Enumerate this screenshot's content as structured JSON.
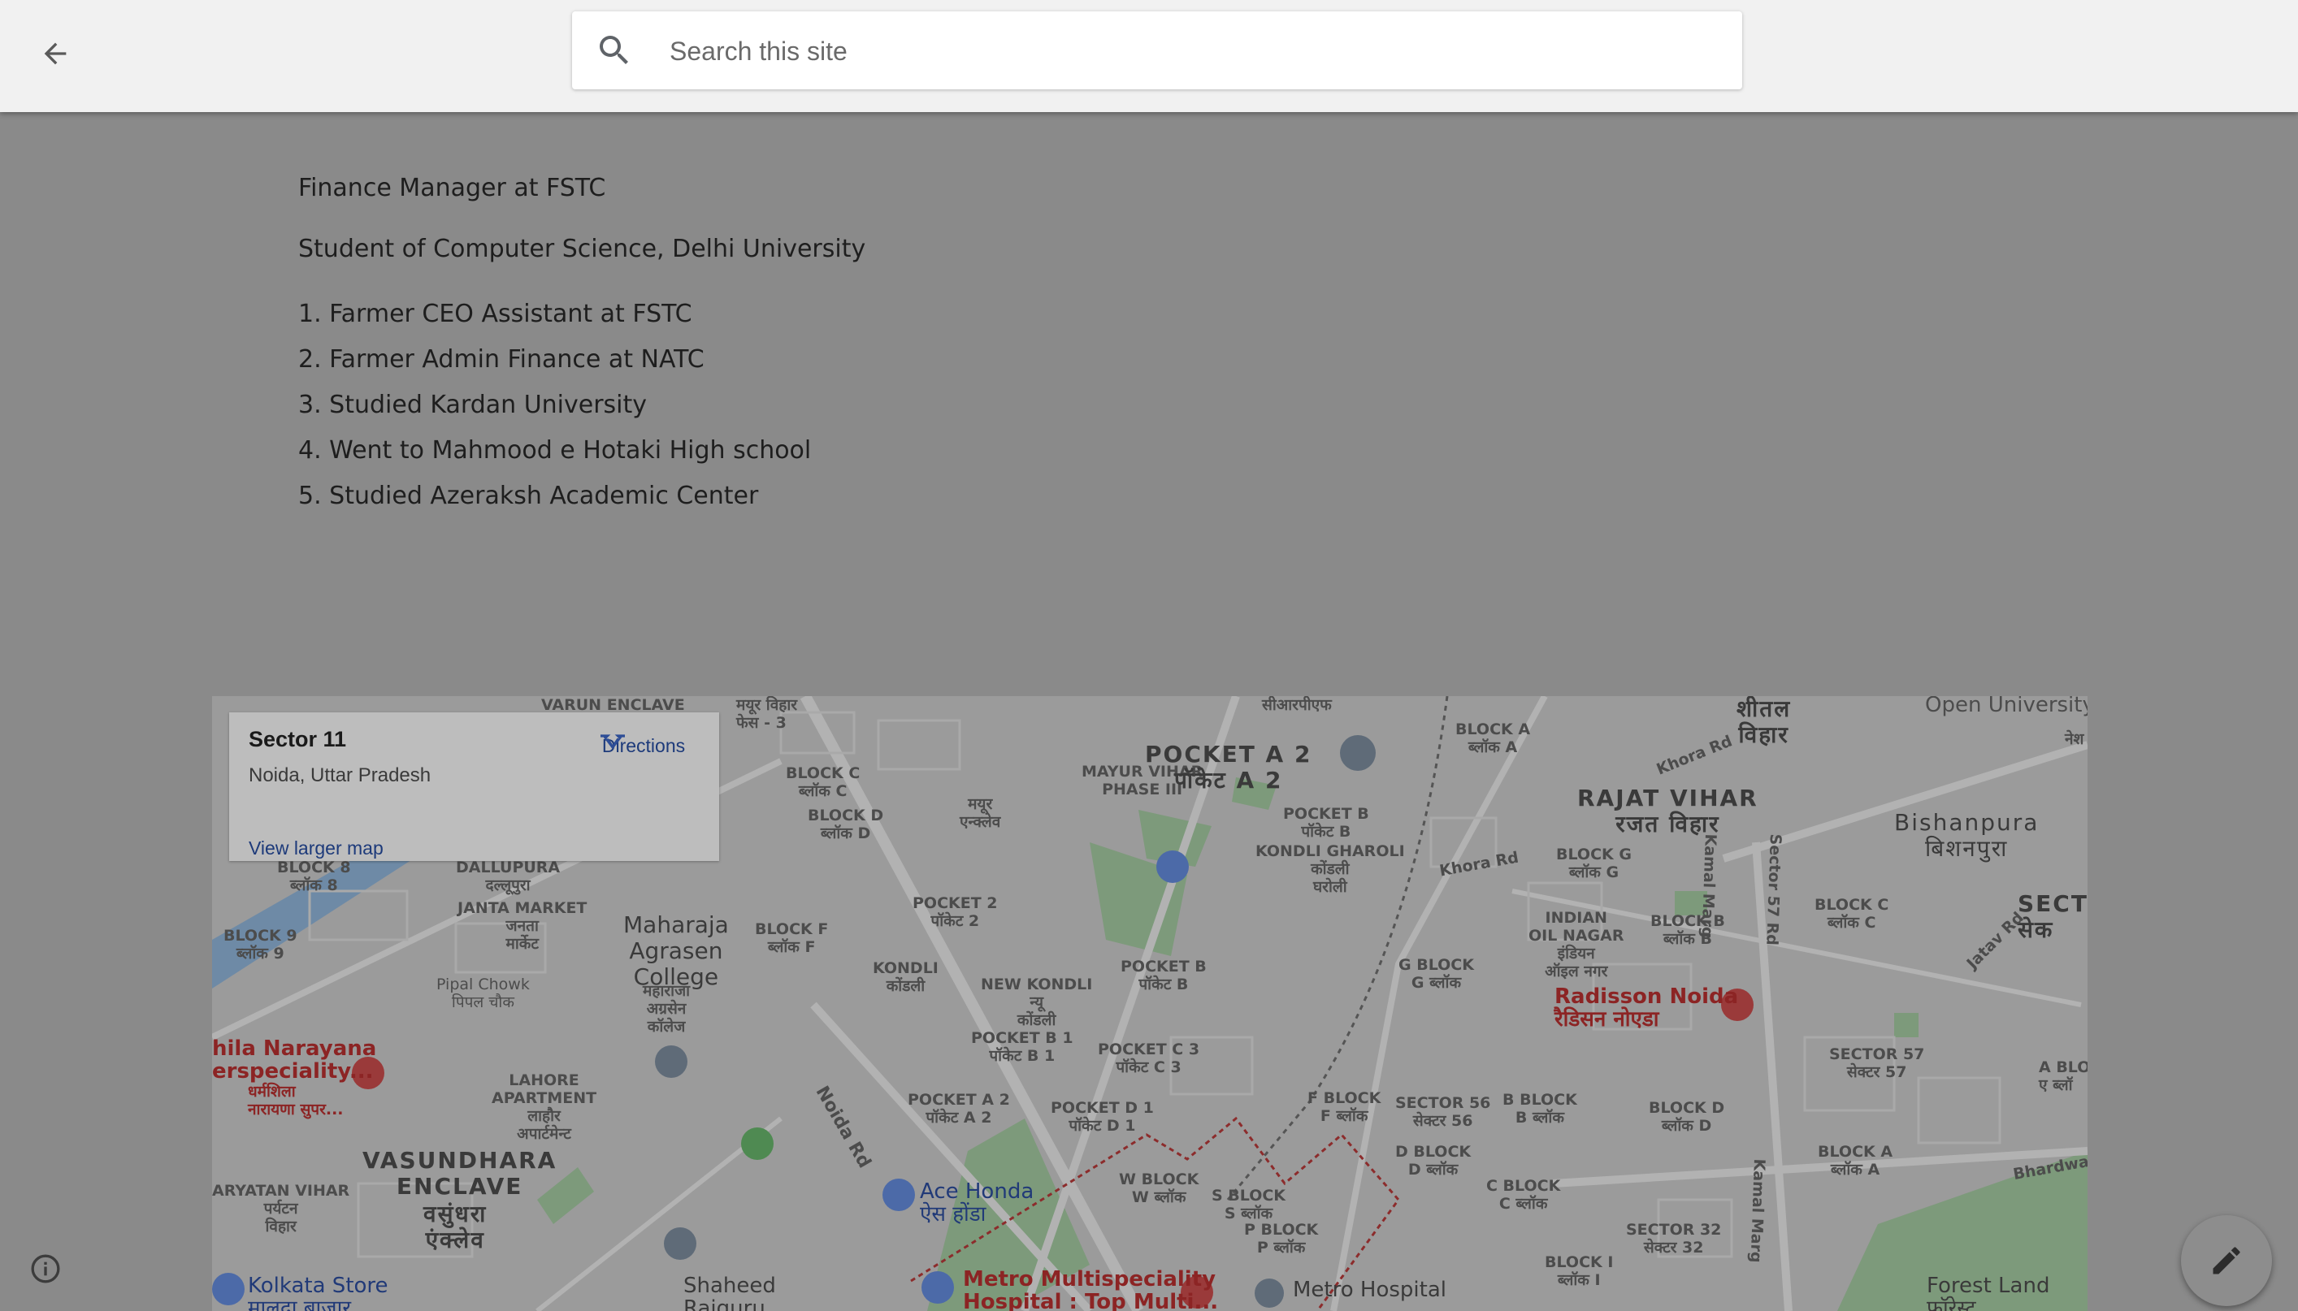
{
  "header": {
    "back_icon": "arrow-back-icon",
    "search_placeholder": "Search this site",
    "search_icon": "search-icon"
  },
  "content": {
    "lines": [
      "Finance Manager at FSTC",
      "Student of Computer Science, Delhi University"
    ],
    "list": [
      "1. Farmer CEO Assistant at FSTC",
      "2. Farmer Admin Finance at NATC",
      "3. Studied Kardan University",
      "4. Went to Mahmood e Hotaki High school",
      "5. Studied Azeraksh Academic Center"
    ]
  },
  "map": {
    "card": {
      "title": "Sector 11",
      "subtitle": "Noida, Uttar Pradesh",
      "link": "View larger map",
      "directions": "Directions"
    },
    "labels": {
      "varun_enclave": "VARUN ENCLAVE",
      "mayur_vihar_phase3": "MAYUR VIHAR\nPHASE III",
      "mayur_vihar_hi": "मयूर\nएन्क्लेव",
      "pocket_a2": "POCKET A 2\nपॉकेट A 2",
      "rajat_vihar": "RAJAT VIHAR\nरजत विहार",
      "sheetal_vihar": "शीतल\nविहार",
      "open_university": "Open University",
      "bishanpura": "Bishanpura\nबिशनपुरा",
      "maharaja_agrasen": "Maharaja\nAgrasen\nCollege",
      "maharaja_agrasen_hi": "महाराजा\nअग्रसेन\nकॉलेज",
      "block8": "BLOCK 8\nब्लॉक 8",
      "block9": "BLOCK 9\nब्लॉक 9",
      "dallupura": "DALLUPURA\nदल्लूपुरा",
      "janta_market": "JANTA MARKET\nजनता\nमार्केट",
      "pipal_chowk": "Pipal Chowk\nपिपल चौक",
      "lahore_apartment": "LAHORE\nAPARTMENT\nलाहौर\nअपार्टमेन्ट",
      "vasundhara_enclave": "VASUNDHARA\nENCLAVE",
      "vasundhara_enclave_hi": "वसुंधरा\nएंक्लेव",
      "aryantan_vihar": "ARYATAN VIHAR\nपर्यटन\nविहार",
      "shaheed": "Shaheed\nRajguru",
      "narayana": "hila Narayana\nerspeciality...",
      "narayana_hi": "धर्मशिला\nनारायणा सुपर...",
      "kolkata_store": "Kolkata Store\nमालदा बाज़ार",
      "ace_honda": "Ace Honda\nऐस होंडा",
      "metro_multispeciality": "Metro Multispeciality\nHospital : Top Multi...",
      "metro_hospital": "Metro Hospital",
      "radisson": "Radisson Noida\nरैडिसन नोएडा",
      "forest_land": "Forest Land\nफ़ॉरेस्ट",
      "noida_rd": "Noida Rd",
      "kamal_marg": "Kamal Marg",
      "khora_rd": "Khora Rd",
      "bhardwaj": "Bhardwa",
      "block_c": "BLOCK C\nब्लॉक C",
      "block_d": "BLOCK D\nब्लॉक D",
      "block_f": "BLOCK F\nब्लॉक F",
      "pocket2": "POCKET 2\nपॉकेट 2",
      "kondli": "KONDLI\nकोंडली",
      "new_kondli": "NEW KONDLI\nन्यू\nकोंडली",
      "pocket_b1": "POCKET B 1\nपॉकेट B 1",
      "pocket_c3": "POCKET C 3\nपॉकेट C 3",
      "pocket_a2_small": "POCKET A 2\nपॉकेट A 2",
      "pocket_d1": "POCKET D 1\nपॉकेट D 1",
      "pocket_b": "POCKET B\nपॉकेट B",
      "pocket_b_kg": "POCKET B\nपॉकेट B",
      "kondli_gharoli": "KONDLI GHAROLI\nकोंडली\nघरोली",
      "g_block": "G BLOCK\nG ब्लॉक",
      "f_block": "F BLOCK\nF ब्लॉक",
      "d_block": "D BLOCK\nD ब्लॉक",
      "c_block": "C BLOCK\nC ब्लॉक",
      "w_block": "W BLOCK\nW ब्लॉक",
      "s_block": "S BLOCK\nS ब्लॉक",
      "p_block": "P BLOCK\nP ब्लॉक",
      "sector56": "SECTOR 56\nसेक्टर 56",
      "b_block": "B BLOCK\nB ब्लॉक",
      "sector32": "SECTOR 32\nसेक्टर 32",
      "block_i": "BLOCK I\nब्लॉक I",
      "block_a_top": "BLOCK A\nब्लॉक A",
      "block_g": "BLOCK G\nब्लॉक G",
      "indian_oil_nagar": "INDIAN\nOIL NAGAR\nइंडियन\nऑइल नगर",
      "block_b": "BLOCK B\nब्लॉक B",
      "block_c_right": "BLOCK C\nब्लॉक C",
      "block_d_right": "BLOCK D\nब्लॉक D",
      "block_a_right": "BLOCK A\nब्लॉक A",
      "sector57": "SECTOR 57\nसेक्टर 57",
      "a_block": "A BLO\nए ब्लॉ",
      "sect": "SECT\nसेक",
      "sector57_road": "Sector 57 Rd",
      "jatav_rd": "Jatav Rd",
      "mayur_vihar_fes": "मयूर विहार\nफेस - 3",
      "nesh": "नेश",
      "cira": "सीआरपीएफ"
    },
    "colors": {
      "map_bg": "#9b9b9b",
      "park_green": "#7d9a7b",
      "road": "#b2b2b2",
      "water": "#6e8aa6",
      "poi_red": "#9a3a3a",
      "poi_blue": "#4c6aa8"
    }
  },
  "footer": {
    "info_icon": "info-icon",
    "edit_icon": "edit-pencil-icon"
  }
}
